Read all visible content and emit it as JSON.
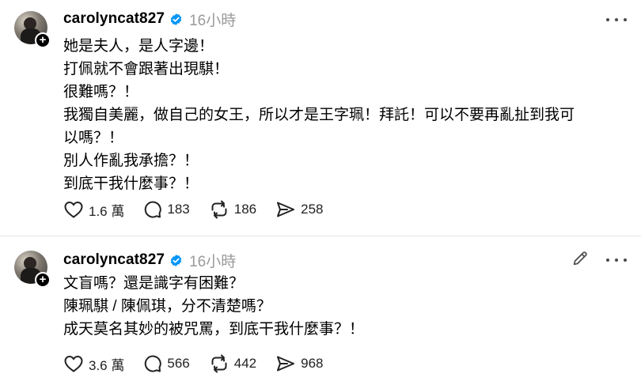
{
  "posts": [
    {
      "username": "carolyncat827",
      "time": "16小時",
      "lines": [
        "她是夫人，是人字邊！",
        "打佩就不會跟著出現騏！",
        "很難嗎？！",
        "我獨自美麗，做自己的女王，所以才是王字珮！拜託！可以不要再亂扯到我可",
        "以嗎？！",
        "別人作亂我承擔？！",
        "到底干我什麼事？！"
      ],
      "likes": "1.6 萬",
      "comments": "183",
      "reposts": "186",
      "shares": "258",
      "editable": false
    },
    {
      "username": "carolyncat827",
      "time": "16小時",
      "lines": [
        "文盲嗎？還是識字有困難？",
        "陳珮騏 / 陳佩琪，分不清楚嗎？",
        "成天莫名其妙的被咒罵，到底干我什麼事？！"
      ],
      "likes": "3.6 萬",
      "comments": "566",
      "reposts": "442",
      "shares": "968",
      "editable": true
    }
  ],
  "colors": {
    "verified": "#0095f6",
    "muted": "#9a9a9a",
    "divider": "#e4e4e4"
  },
  "icons": [
    "plus-icon",
    "verified-badge-icon",
    "more-icon",
    "edit-icon",
    "heart-icon",
    "comment-icon",
    "repost-icon",
    "share-icon"
  ]
}
